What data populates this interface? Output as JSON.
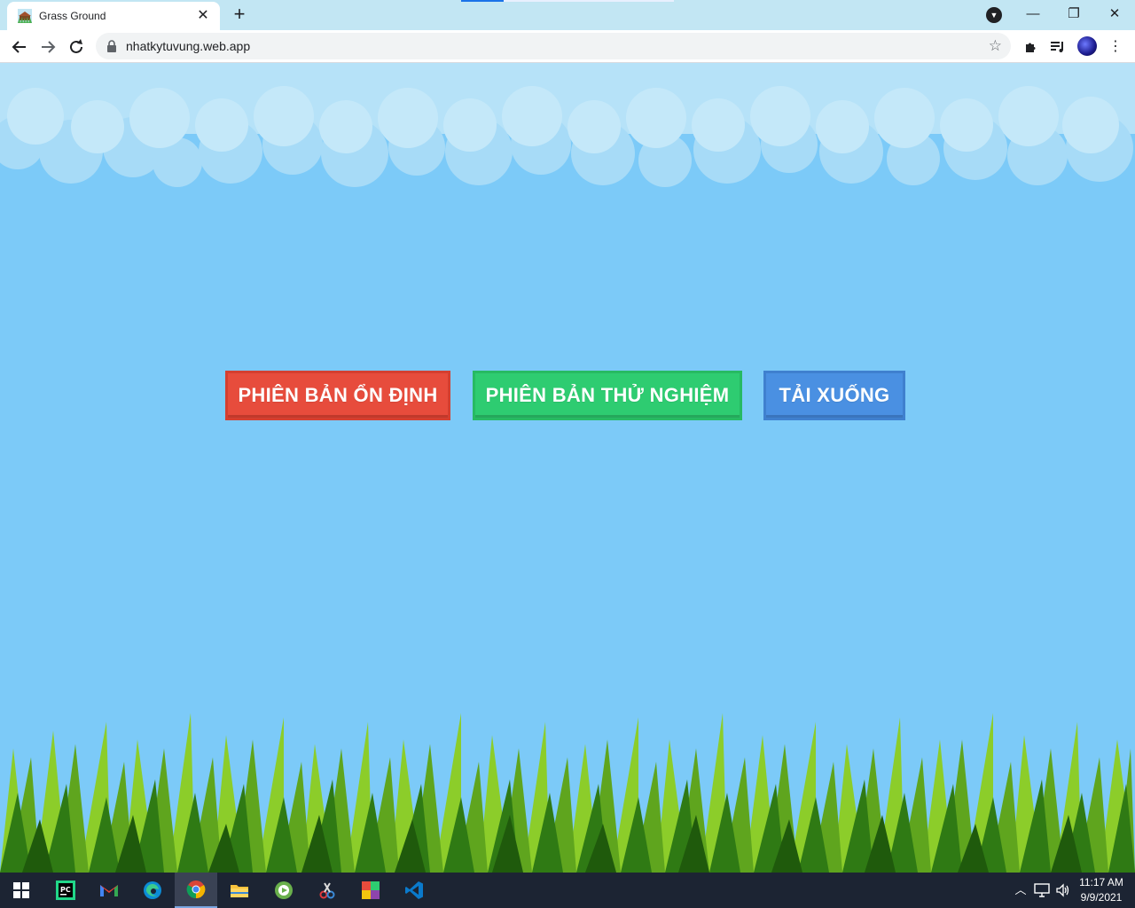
{
  "browser": {
    "tab_title": "Grass Ground",
    "tab_close": "✕",
    "new_tab": "+",
    "url": "nhatkytuvung.web.app",
    "window_minimize": "—",
    "window_restore": "❐",
    "window_close": "✕"
  },
  "page": {
    "buttons": {
      "stable": "PHIÊN BẢN ỔN ĐỊNH",
      "beta": "PHIÊN BẢN THỬ NGHIỆM",
      "download": "TẢI XUỐNG"
    },
    "colors": {
      "sky": "#7ccaf8",
      "stable": "#e74c3c",
      "beta": "#2ecc71",
      "download": "#4a90e2"
    }
  },
  "taskbar": {
    "apps": [
      "windows-start",
      "pycharm",
      "gmail",
      "edge",
      "chrome",
      "file-explorer",
      "app-green",
      "app-snip",
      "app-colorful",
      "vscode"
    ],
    "time": "11:17 AM",
    "date": "9/9/2021"
  }
}
